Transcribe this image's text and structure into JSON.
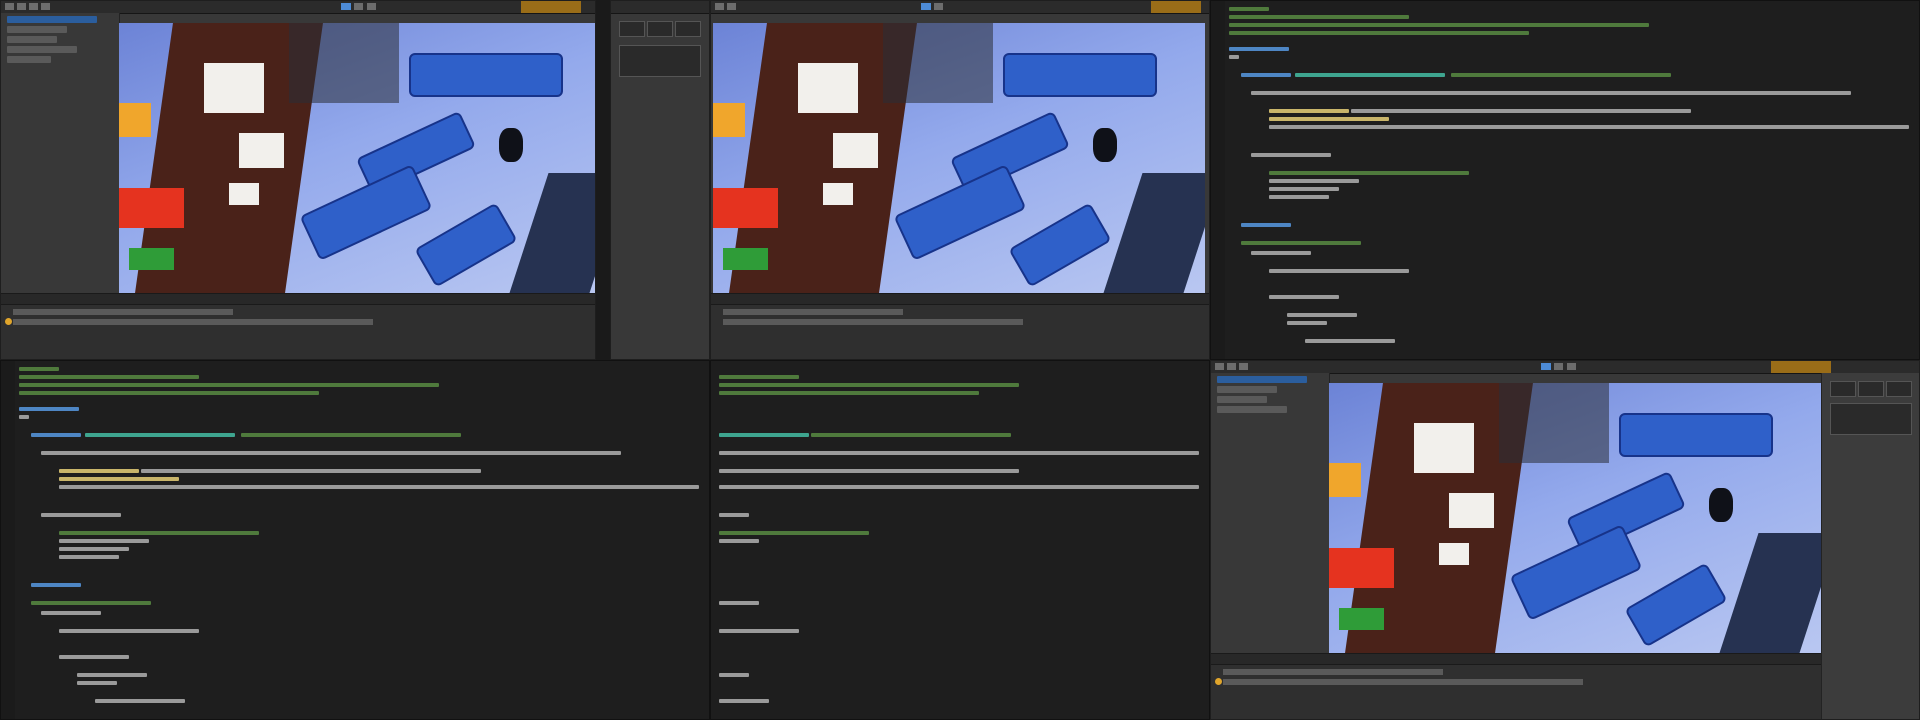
{
  "screens": {
    "top_left": {
      "type": "unity-editor",
      "window_title": "",
      "status": "warning"
    },
    "top_middle": {
      "type": "unity-editor",
      "window_title": "",
      "status": "warning"
    },
    "top_right": {
      "type": "code-editor",
      "window_title": ""
    },
    "bottom_left": {
      "type": "code-editor",
      "window_title": ""
    },
    "bottom_middle": {
      "type": "code-editor",
      "window_title": ""
    },
    "bottom_right": {
      "type": "unity-editor",
      "window_title": "",
      "status": "warning"
    }
  },
  "icons": {
    "play": "play-icon",
    "pause": "pause-icon",
    "step": "step-icon",
    "warning": "warning-icon"
  },
  "colors": {
    "editor_bg": "#383838",
    "code_bg": "#1e1e1e",
    "accent_blue": "#2b5e9e",
    "warning_yellow": "#e0a52b",
    "comment_green": "#4f7a3c",
    "keyword_blue": "#4e86c4"
  }
}
